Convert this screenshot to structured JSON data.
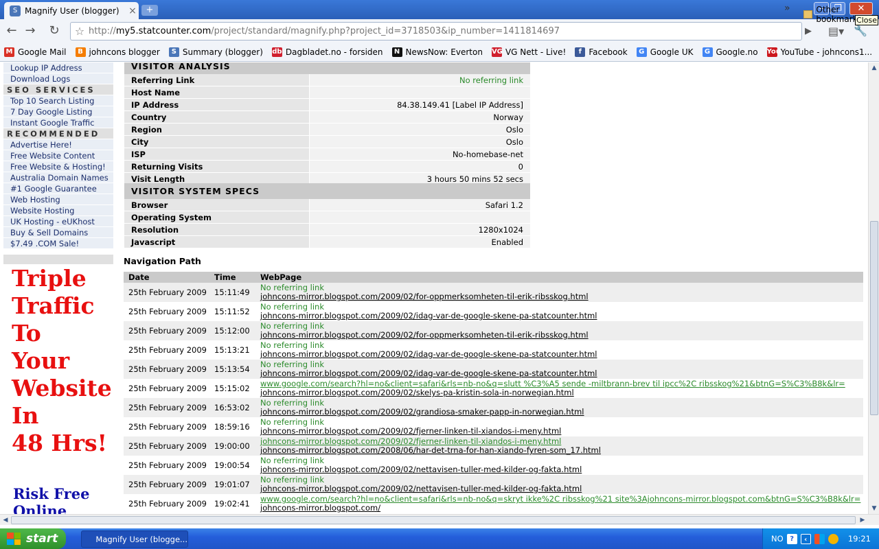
{
  "browser": {
    "tab_title": "Magnify User (blogger)",
    "tooltip": "Close",
    "url_scheme": "http://",
    "url_host": "my5.statcounter.com",
    "url_path": "/project/standard/magnify.php?project_id=3718503&ip_number=1411814697"
  },
  "bookmarks": [
    {
      "label": "Google Mail",
      "icon": "M",
      "color": "#d93025"
    },
    {
      "label": "johncons blogger",
      "icon": "B",
      "color": "#f57d00"
    },
    {
      "label": "Summary (blogger)",
      "icon": "S",
      "color": "#4a76b8"
    },
    {
      "label": "Dagbladet.no - forsiden",
      "icon": "db",
      "color": "#d0202e"
    },
    {
      "label": "NewsNow: Everton",
      "icon": "N",
      "color": "#111111"
    },
    {
      "label": "VG Nett - Live!",
      "icon": "VG",
      "color": "#d0202e"
    },
    {
      "label": "Facebook",
      "icon": "f",
      "color": "#3b5998"
    },
    {
      "label": "Google UK",
      "icon": "G",
      "color": "#4285f4"
    },
    {
      "label": "Google.no",
      "icon": "G",
      "color": "#4285f4"
    },
    {
      "label": "YouTube - johncons1...",
      "icon": "You",
      "color": "#cc181e"
    }
  ],
  "bookmarks_other": "Other bookmarks",
  "sidebar": {
    "links_top": [
      "Lookup IP Address",
      "Download Logs"
    ],
    "seo_heading": "SEO SERVICES",
    "seo_links": [
      "Top 10 Search Listing",
      "7 Day Google Listing",
      "Instant Google Traffic"
    ],
    "rec_heading": "RECOMMENDED",
    "rec_links": [
      "Advertise Here!",
      "Free Website Content",
      "Free Website & Hosting!",
      "Australia Domain Names",
      "#1 Google Guarantee",
      "Web Hosting",
      "Website Hosting",
      "UK Hosting - eUKhost",
      "Buy & Sell Domains",
      "$7.49 .COM Sale!"
    ]
  },
  "ad": {
    "lines": [
      "Triple",
      "Traffic",
      "To",
      "Your",
      "Website",
      "In",
      "48 Hrs!"
    ],
    "lines2": [
      "Risk Free",
      "Online"
    ]
  },
  "visitor_analysis": {
    "heading": "VISITOR ANALYSIS",
    "rows": [
      {
        "label": "Referring Link",
        "value": "No referring link",
        "green": true
      },
      {
        "label": "Host Name",
        "value": ""
      },
      {
        "label": "IP Address",
        "value": "84.38.149.41 [Label IP Address]"
      },
      {
        "label": "Country",
        "value": "Norway"
      },
      {
        "label": "Region",
        "value": "Oslo"
      },
      {
        "label": "City",
        "value": "Oslo"
      },
      {
        "label": "ISP",
        "value": "No-homebase-net"
      },
      {
        "label": "Returning Visits",
        "value": "0"
      },
      {
        "label": "Visit Length",
        "value": "3 hours 50 mins 52 secs"
      }
    ]
  },
  "system_specs": {
    "heading": "VISITOR SYSTEM SPECS",
    "rows": [
      {
        "label": "Browser",
        "value": "Safari 1.2"
      },
      {
        "label": "Operating System",
        "value": ""
      },
      {
        "label": "Resolution",
        "value": "1280x1024"
      },
      {
        "label": "Javascript",
        "value": "Enabled"
      }
    ]
  },
  "navigation": {
    "title": "Navigation Path",
    "headers": [
      "Date",
      "Time",
      "WebPage"
    ],
    "rows": [
      {
        "date": "25th February 2009",
        "time": "15:11:49",
        "ref": "No referring link",
        "ref_link": false,
        "page": "johncons-mirror.blogspot.com/2009/02/for-oppmerksomheten-til-erik-ribsskog.html"
      },
      {
        "date": "25th February 2009",
        "time": "15:11:52",
        "ref": "No referring link",
        "ref_link": false,
        "page": "johncons-mirror.blogspot.com/2009/02/idag-var-de-google-skene-pa-statcounter.html"
      },
      {
        "date": "25th February 2009",
        "time": "15:12:00",
        "ref": "No referring link",
        "ref_link": false,
        "page": "johncons-mirror.blogspot.com/2009/02/for-oppmerksomheten-til-erik-ribsskog.html"
      },
      {
        "date": "25th February 2009",
        "time": "15:13:21",
        "ref": "No referring link",
        "ref_link": false,
        "page": "johncons-mirror.blogspot.com/2009/02/idag-var-de-google-skene-pa-statcounter.html"
      },
      {
        "date": "25th February 2009",
        "time": "15:13:54",
        "ref": "No referring link",
        "ref_link": false,
        "page": "johncons-mirror.blogspot.com/2009/02/idag-var-de-google-skene-pa-statcounter.html"
      },
      {
        "date": "25th February 2009",
        "time": "15:15:02",
        "ref": "www.google.com/search?hl=no&client=safari&rls=nb-no&q=slutt %C3%A5 sende -miltbrann-brev til ipcc%2C ribsskog%21&btnG=S%C3%B8k&lr=",
        "ref_link": true,
        "page": "johncons-mirror.blogspot.com/2009/02/skelys-pa-kristin-sola-in-norwegian.html"
      },
      {
        "date": "25th February 2009",
        "time": "16:53:02",
        "ref": "No referring link",
        "ref_link": false,
        "page": "johncons-mirror.blogspot.com/2009/02/grandiosa-smaker-papp-in-norwegian.html"
      },
      {
        "date": "25th February 2009",
        "time": "18:59:16",
        "ref": "No referring link",
        "ref_link": false,
        "page": "johncons-mirror.blogspot.com/2009/02/fjerner-linken-til-xiandos-i-meny.html"
      },
      {
        "date": "25th February 2009",
        "time": "19:00:00",
        "ref": "johncons-mirror.blogspot.com/2009/02/fjerner-linken-til-xiandos-i-meny.html",
        "ref_link": true,
        "page": "johncons-mirror.blogspot.com/2008/06/har-det-trna-for-han-xiando-fyren-som_17.html"
      },
      {
        "date": "25th February 2009",
        "time": "19:00:54",
        "ref": "No referring link",
        "ref_link": false,
        "page": "johncons-mirror.blogspot.com/2009/02/nettavisen-tuller-med-kilder-og-fakta.html"
      },
      {
        "date": "25th February 2009",
        "time": "19:01:07",
        "ref": "No referring link",
        "ref_link": false,
        "page": "johncons-mirror.blogspot.com/2009/02/nettavisen-tuller-med-kilder-og-fakta.html"
      },
      {
        "date": "25th February 2009",
        "time": "19:02:41",
        "ref": "www.google.com/search?hl=no&client=safari&rls=nb-no&q=skryt ikke%2C ribsskog%21 site%3Ajohncons-mirror.blogspot.com&btnG=S%C3%B8k&lr=",
        "ref_link": true,
        "page": "johncons-mirror.blogspot.com/"
      }
    ]
  },
  "taskbar": {
    "start": "start",
    "item": "Magnify User (blogge...",
    "lang": "NO",
    "clock": "19:21"
  }
}
